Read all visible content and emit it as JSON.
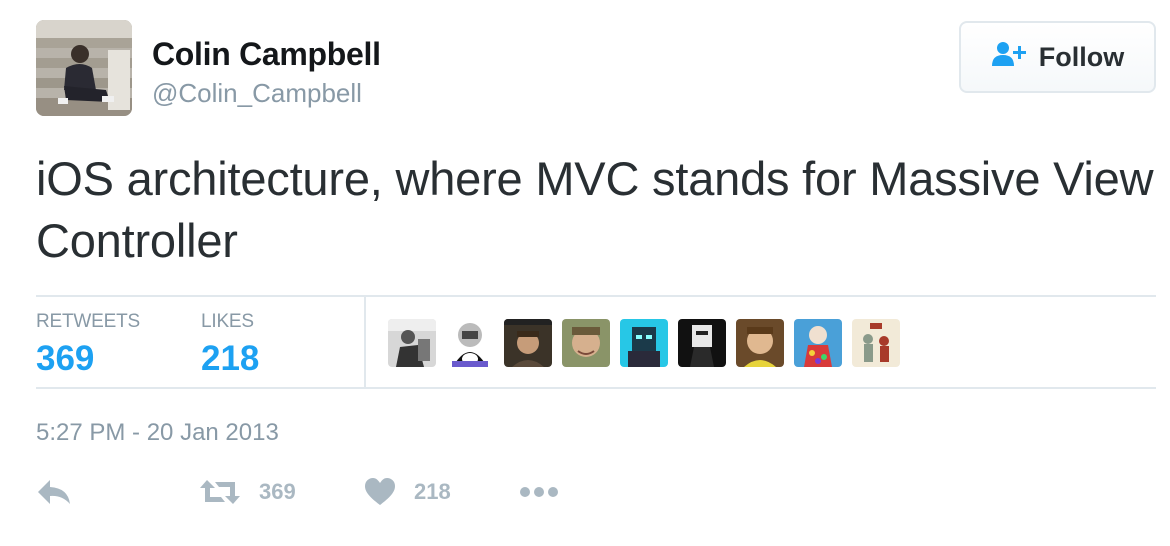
{
  "user": {
    "name": "Colin Campbell",
    "handle": "@Colin_Campbell"
  },
  "follow_button": {
    "label": "Follow",
    "icon": "follow-user-plus-icon"
  },
  "tweet": {
    "text": "iOS architecture, where MVC stands for Massive View Controller",
    "timestamp": "5:27 PM - 20 Jan 2013"
  },
  "stats": {
    "retweets_label": "RETWEETS",
    "retweets_count": "369",
    "likes_label": "LIKES",
    "likes_count": "218"
  },
  "actions": {
    "reply_icon": "reply-icon",
    "retweet_icon": "retweet-icon",
    "retweet_count": "369",
    "like_icon": "heart-icon",
    "like_count": "218",
    "more_icon": "more-dots-icon"
  },
  "colors": {
    "accent": "#1da1f2",
    "muted": "#8899a6",
    "icon_muted": "#aab8c2",
    "border": "#e1e8ed",
    "text": "#292f33"
  }
}
